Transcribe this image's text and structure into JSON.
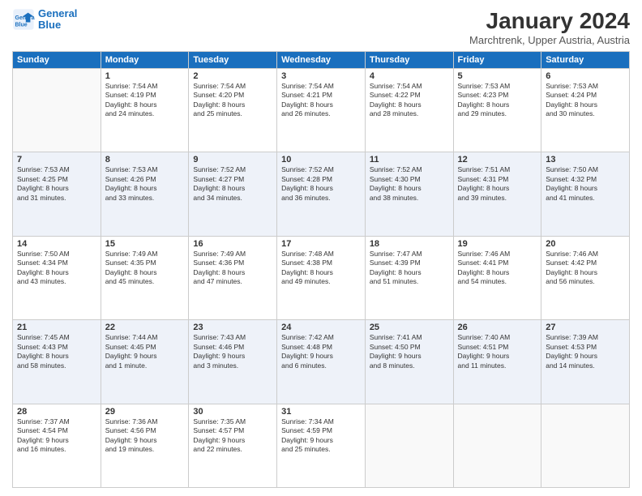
{
  "header": {
    "logo_line1": "General",
    "logo_line2": "Blue",
    "title": "January 2024",
    "subtitle": "Marchtrenk, Upper Austria, Austria"
  },
  "weekdays": [
    "Sunday",
    "Monday",
    "Tuesday",
    "Wednesday",
    "Thursday",
    "Friday",
    "Saturday"
  ],
  "weeks": [
    [
      {
        "day": "",
        "info": ""
      },
      {
        "day": "1",
        "info": "Sunrise: 7:54 AM\nSunset: 4:19 PM\nDaylight: 8 hours\nand 24 minutes."
      },
      {
        "day": "2",
        "info": "Sunrise: 7:54 AM\nSunset: 4:20 PM\nDaylight: 8 hours\nand 25 minutes."
      },
      {
        "day": "3",
        "info": "Sunrise: 7:54 AM\nSunset: 4:21 PM\nDaylight: 8 hours\nand 26 minutes."
      },
      {
        "day": "4",
        "info": "Sunrise: 7:54 AM\nSunset: 4:22 PM\nDaylight: 8 hours\nand 28 minutes."
      },
      {
        "day": "5",
        "info": "Sunrise: 7:53 AM\nSunset: 4:23 PM\nDaylight: 8 hours\nand 29 minutes."
      },
      {
        "day": "6",
        "info": "Sunrise: 7:53 AM\nSunset: 4:24 PM\nDaylight: 8 hours\nand 30 minutes."
      }
    ],
    [
      {
        "day": "7",
        "info": "Sunrise: 7:53 AM\nSunset: 4:25 PM\nDaylight: 8 hours\nand 31 minutes."
      },
      {
        "day": "8",
        "info": "Sunrise: 7:53 AM\nSunset: 4:26 PM\nDaylight: 8 hours\nand 33 minutes."
      },
      {
        "day": "9",
        "info": "Sunrise: 7:52 AM\nSunset: 4:27 PM\nDaylight: 8 hours\nand 34 minutes."
      },
      {
        "day": "10",
        "info": "Sunrise: 7:52 AM\nSunset: 4:28 PM\nDaylight: 8 hours\nand 36 minutes."
      },
      {
        "day": "11",
        "info": "Sunrise: 7:52 AM\nSunset: 4:30 PM\nDaylight: 8 hours\nand 38 minutes."
      },
      {
        "day": "12",
        "info": "Sunrise: 7:51 AM\nSunset: 4:31 PM\nDaylight: 8 hours\nand 39 minutes."
      },
      {
        "day": "13",
        "info": "Sunrise: 7:50 AM\nSunset: 4:32 PM\nDaylight: 8 hours\nand 41 minutes."
      }
    ],
    [
      {
        "day": "14",
        "info": "Sunrise: 7:50 AM\nSunset: 4:34 PM\nDaylight: 8 hours\nand 43 minutes."
      },
      {
        "day": "15",
        "info": "Sunrise: 7:49 AM\nSunset: 4:35 PM\nDaylight: 8 hours\nand 45 minutes."
      },
      {
        "day": "16",
        "info": "Sunrise: 7:49 AM\nSunset: 4:36 PM\nDaylight: 8 hours\nand 47 minutes."
      },
      {
        "day": "17",
        "info": "Sunrise: 7:48 AM\nSunset: 4:38 PM\nDaylight: 8 hours\nand 49 minutes."
      },
      {
        "day": "18",
        "info": "Sunrise: 7:47 AM\nSunset: 4:39 PM\nDaylight: 8 hours\nand 51 minutes."
      },
      {
        "day": "19",
        "info": "Sunrise: 7:46 AM\nSunset: 4:41 PM\nDaylight: 8 hours\nand 54 minutes."
      },
      {
        "day": "20",
        "info": "Sunrise: 7:46 AM\nSunset: 4:42 PM\nDaylight: 8 hours\nand 56 minutes."
      }
    ],
    [
      {
        "day": "21",
        "info": "Sunrise: 7:45 AM\nSunset: 4:43 PM\nDaylight: 8 hours\nand 58 minutes."
      },
      {
        "day": "22",
        "info": "Sunrise: 7:44 AM\nSunset: 4:45 PM\nDaylight: 9 hours\nand 1 minute."
      },
      {
        "day": "23",
        "info": "Sunrise: 7:43 AM\nSunset: 4:46 PM\nDaylight: 9 hours\nand 3 minutes."
      },
      {
        "day": "24",
        "info": "Sunrise: 7:42 AM\nSunset: 4:48 PM\nDaylight: 9 hours\nand 6 minutes."
      },
      {
        "day": "25",
        "info": "Sunrise: 7:41 AM\nSunset: 4:50 PM\nDaylight: 9 hours\nand 8 minutes."
      },
      {
        "day": "26",
        "info": "Sunrise: 7:40 AM\nSunset: 4:51 PM\nDaylight: 9 hours\nand 11 minutes."
      },
      {
        "day": "27",
        "info": "Sunrise: 7:39 AM\nSunset: 4:53 PM\nDaylight: 9 hours\nand 14 minutes."
      }
    ],
    [
      {
        "day": "28",
        "info": "Sunrise: 7:37 AM\nSunset: 4:54 PM\nDaylight: 9 hours\nand 16 minutes."
      },
      {
        "day": "29",
        "info": "Sunrise: 7:36 AM\nSunset: 4:56 PM\nDaylight: 9 hours\nand 19 minutes."
      },
      {
        "day": "30",
        "info": "Sunrise: 7:35 AM\nSunset: 4:57 PM\nDaylight: 9 hours\nand 22 minutes."
      },
      {
        "day": "31",
        "info": "Sunrise: 7:34 AM\nSunset: 4:59 PM\nDaylight: 9 hours\nand 25 minutes."
      },
      {
        "day": "",
        "info": ""
      },
      {
        "day": "",
        "info": ""
      },
      {
        "day": "",
        "info": ""
      }
    ]
  ]
}
